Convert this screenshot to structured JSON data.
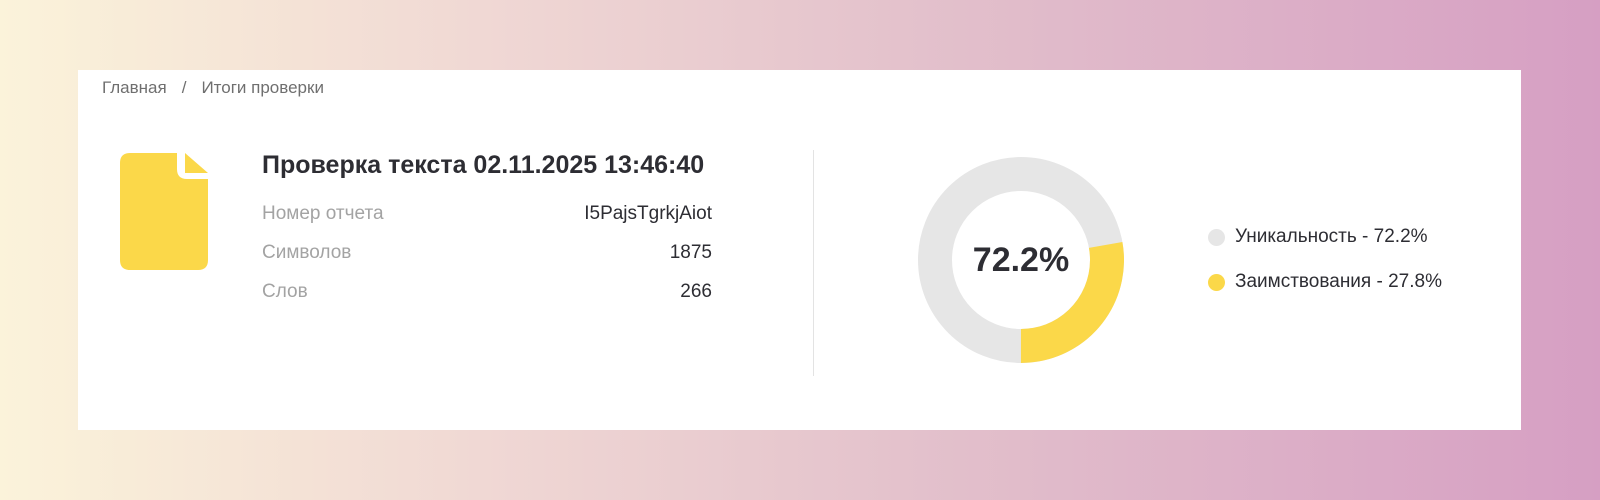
{
  "breadcrumb": {
    "home": "Главная",
    "separator": "/",
    "current": "Итоги проверки"
  },
  "report": {
    "title": "Проверка текста 02.11.2025 13:46:40",
    "rows": [
      {
        "label": "Номер отчета",
        "value": "I5PajsTgrkjAiot"
      },
      {
        "label": "Символов",
        "value": "1875"
      },
      {
        "label": "Слов",
        "value": "266"
      }
    ]
  },
  "chart_data": {
    "type": "pie",
    "center_label": "72.2%",
    "slices": [
      {
        "label": "Уникальность - 72.2%",
        "value": 72.2,
        "color": "#e6e6e6"
      },
      {
        "label": "Заимствования - 27.8%",
        "value": 27.8,
        "color": "#fbd849"
      }
    ]
  },
  "colors": {
    "accent": "#fbd849",
    "unique": "#e6e6e6"
  },
  "icons": {
    "document": "document-icon"
  }
}
